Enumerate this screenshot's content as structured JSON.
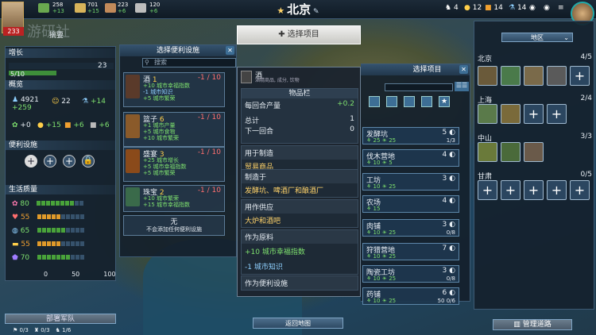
{
  "top": {
    "res1": "258",
    "res1d": "+13",
    "res2": "701",
    "res2d": "+15",
    "res3": "223",
    "res3d": "+6",
    "res4": "120",
    "res4d": "+6",
    "city": "北京",
    "r1": "4",
    "r2": "12",
    "r3": "14",
    "r4": "14"
  },
  "player": {
    "pop": "233",
    "tab": "摘要"
  },
  "left": {
    "growth_title": "增长",
    "growth_val": "23",
    "growth_prog": "5/10",
    "overview_title": "概览",
    "ov1": "4921",
    "ov1b": "+259",
    "ov2": "22",
    "ov3": "+14",
    "ov4": "+0",
    "ov5": "+15",
    "ov6": "+6",
    "ov7": "+6",
    "amen_title": "便利设施",
    "qol_title": "生活质量",
    "q": [
      "80",
      "55",
      "65",
      "55",
      "70"
    ],
    "axis": [
      "0",
      "50",
      "100"
    ],
    "army": "部署军队",
    "f1": "0/3",
    "f2": "0/3",
    "f3": "1/6"
  },
  "amen": {
    "title": "选择便利设施",
    "search": "搜索",
    "items": [
      {
        "name": "酒",
        "lvl": "1",
        "val": "-1 / 10",
        "l1": "+10 城市幸福指数",
        "l2": "-1 城市知识",
        "l3": "+5 城市繁荣"
      },
      {
        "name": "篮子",
        "lvl": "6",
        "val": "-1 / 10",
        "l1": "+1 城市产量",
        "l2": "+5 城市食物",
        "l3": "+10 城市繁荣"
      },
      {
        "name": "盛宴",
        "lvl": "3",
        "val": "-1 / 10",
        "l1": "+25 城市增长",
        "l2": "+5 城市幸福指数",
        "l3": "+5 城市繁荣"
      },
      {
        "name": "珠宝",
        "lvl": "2",
        "val": "-1 / 10",
        "l1": "+10 城市繁荣",
        "l2": "+15 城市幸福指数",
        "l3": ""
      }
    ],
    "none_title": "无",
    "none_sub": "不会添加任何便利设施"
  },
  "tip": {
    "name": "酒",
    "sub": "酒精商品, 成分, 饮物",
    "inv": "物品栏",
    "prod": "每回合产量",
    "prod_v": "+0.2",
    "total": "总计",
    "total_v": "1",
    "next": "下一回合",
    "next_v": "0",
    "made_title": "用于制造",
    "made": "贸易商品",
    "by_title": "制造于",
    "by": "发酵坑、啤酒厂和酿酒厂",
    "use_title": "用作供应",
    "use": "大炉和酒吧",
    "raw_title": "作为原料",
    "raw1": "+10 城市幸福指数",
    "raw2": "-1 城市知识",
    "amen_title": "作为便利设施"
  },
  "project": {
    "add": "选择项目",
    "title": "选择项目",
    "items": [
      {
        "name": "发酵坑",
        "n": "5",
        "a": "25",
        "b": "25",
        "c": "1/3"
      },
      {
        "name": "伐木营地",
        "n": "4",
        "a": "10",
        "b": "5",
        "c": ""
      },
      {
        "name": "工坊",
        "n": "3",
        "a": "10",
        "b": "25",
        "c": ""
      },
      {
        "name": "农场",
        "n": "4",
        "a": "15",
        "b": "",
        "c": ""
      },
      {
        "name": "肉铺",
        "n": "3",
        "a": "10",
        "b": "25",
        "c": "0/8"
      },
      {
        "name": "狩猎营地",
        "n": "7",
        "a": "10",
        "b": "25",
        "c": ""
      },
      {
        "name": "陶瓷工坊",
        "n": "3",
        "a": "10",
        "b": "25",
        "c": "0/8"
      },
      {
        "name": "药铺",
        "n": "6",
        "a": "10",
        "b": "25",
        "c": "50 0/6"
      }
    ]
  },
  "right": {
    "region": "地区",
    "cities": [
      {
        "name": "北京",
        "count": "4/5"
      },
      {
        "name": "上海",
        "count": "2/4"
      },
      {
        "name": "中山",
        "count": "3/3"
      },
      {
        "name": "甘肃",
        "count": "0/5"
      }
    ],
    "manage": "管理道路"
  },
  "bottom": {
    "back": "返回地图"
  }
}
